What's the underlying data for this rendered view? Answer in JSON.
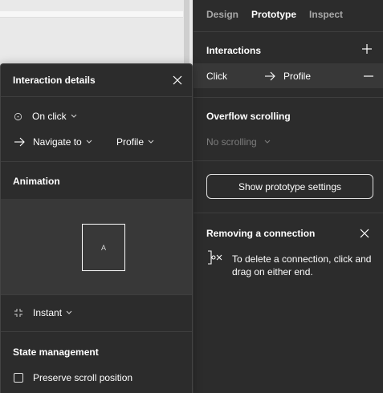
{
  "tabs": [
    {
      "label": "Design"
    },
    {
      "label": "Prototype"
    },
    {
      "label": "Inspect"
    }
  ],
  "interactions": {
    "title": "Interactions",
    "row": {
      "trigger": "Click",
      "target": "Profile"
    }
  },
  "overflow": {
    "title": "Overflow scrolling",
    "value": "No scrolling"
  },
  "prototype_settings_button": "Show prototype settings",
  "tip": {
    "title": "Removing a connection",
    "text": "To delete a connection, click and drag on either end."
  },
  "details": {
    "title": "Interaction details",
    "trigger": "On click",
    "action": "Navigate to",
    "destination": "Profile",
    "animation_title": "Animation",
    "preview_label": "A",
    "transition": "Instant",
    "state_title": "State management",
    "preserve_scroll": "Preserve scroll position",
    "preserve_scroll_checked": false
  },
  "colors": {
    "panel_bg": "#2c2c2c",
    "canvas_bg": "#e9e9e9",
    "row_highlight": "#383838",
    "muted_text": "#7d7d7d"
  }
}
